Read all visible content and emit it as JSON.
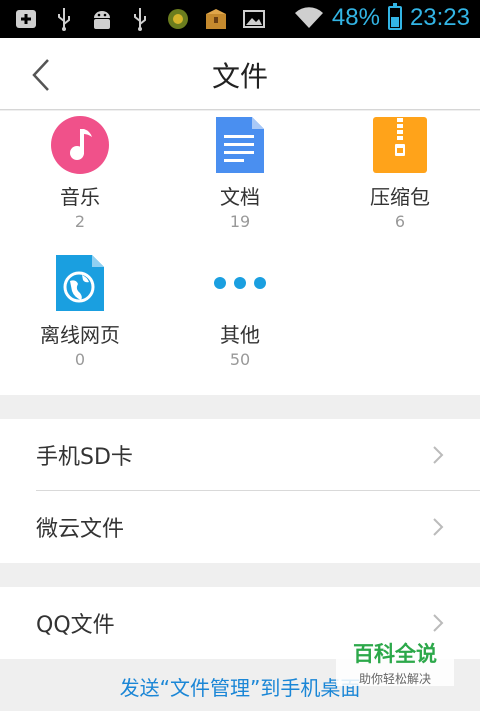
{
  "status_bar": {
    "battery": "48%",
    "time": "23:23",
    "icons": [
      "add-notification-icon",
      "usb-icon",
      "android-debug-icon",
      "usb-icon",
      "app-icon",
      "box-app-icon",
      "image-icon",
      "wifi-icon",
      "battery-icon"
    ],
    "accent": "#33b5e5"
  },
  "header": {
    "title": "文件"
  },
  "categories": [
    {
      "label": "音乐",
      "count": "2",
      "icon": "music-icon",
      "color": "#f0518a"
    },
    {
      "label": "文档",
      "count": "19",
      "icon": "document-icon",
      "color": "#4a8ff0"
    },
    {
      "label": "压缩包",
      "count": "6",
      "icon": "archive-icon",
      "color": "#ffa31a"
    },
    {
      "label": "离线网页",
      "count": "0",
      "icon": "offline-webpage-icon",
      "color": "#1a9fe0"
    },
    {
      "label": "其他",
      "count": "50",
      "icon": "more-icon",
      "color": "#1a9fe0"
    }
  ],
  "locations": [
    {
      "label": "手机SD卡"
    },
    {
      "label": "微云文件"
    }
  ],
  "qq_files": {
    "label": "QQ文件"
  },
  "bottom_link": "发送“文件管理”到手机桌面",
  "watermark": {
    "title": "百科全说",
    "subtitle": "助你轻松解决"
  }
}
